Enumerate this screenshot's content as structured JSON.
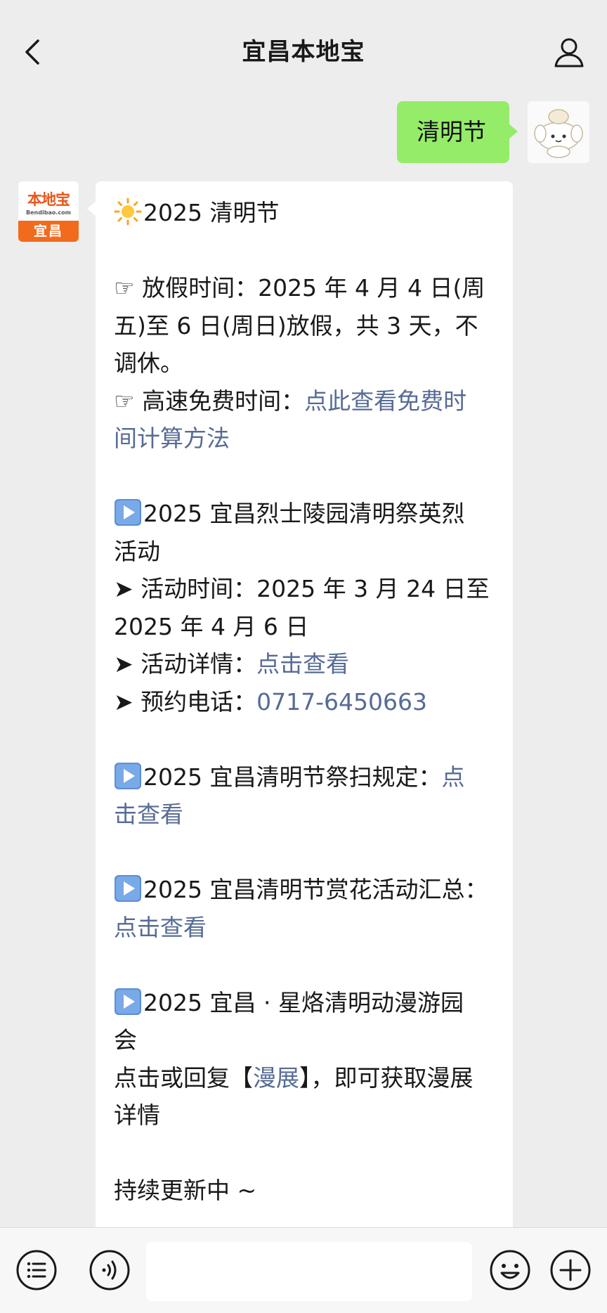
{
  "header": {
    "title": "宜昌本地宝"
  },
  "outgoing_message": {
    "text": "清明节"
  },
  "bot_avatar": {
    "brand": "本地宝",
    "domain": "Bendibao.com",
    "city": "宜昌"
  },
  "incoming_message": {
    "l1": "2025 清明节",
    "l2": "☞ 放假时间：2025 年 4 月 4 日(周",
    "l3": "五)至 6 日(周日)放假，共 3 天，不",
    "l4": "调休。",
    "l5a": "☞ 高速免费时间：",
    "l5b": "点此查看免费时",
    "l6": "间计算方法",
    "l7": "2025 宜昌烈士陵园清明祭英烈",
    "l8": "活动",
    "l9": "➤ 活动时间：2025 年 3 月 24 日至",
    "l10": "2025 年 4 月 6 日",
    "l11a": "➤ 活动详情：",
    "l11b": "点击查看",
    "l12a": "➤ 预约电话：",
    "l12b": "0717-6450663",
    "l13a": "2025 宜昌清明节祭扫规定：",
    "l13b": "点",
    "l14": "击查看",
    "l15": "2025 宜昌清明节赏花活动汇总：",
    "l16": "点击查看",
    "l17": "2025 宜昌 · 星烙清明动漫游园",
    "l18": "会",
    "l19a": "点击或回复【",
    "l19b": "漫展",
    "l19c": "】，即可获取漫展",
    "l20": "详情",
    "l21": "持续更新中 ~"
  },
  "input_bar": {
    "placeholder": ""
  },
  "icons": {
    "back": "chevron-left-icon",
    "profile": "person-icon",
    "menu": "list-icon",
    "voice": "voice-icon",
    "emoji": "smiley-icon",
    "plus": "plus-icon",
    "sun": "sun-icon",
    "play": "play-icon"
  },
  "colors": {
    "background": "#ededed",
    "outgoing_bubble": "#95ec69",
    "incoming_bubble": "#ffffff",
    "link": "#576b95",
    "brand_orange": "#f26b1d"
  }
}
